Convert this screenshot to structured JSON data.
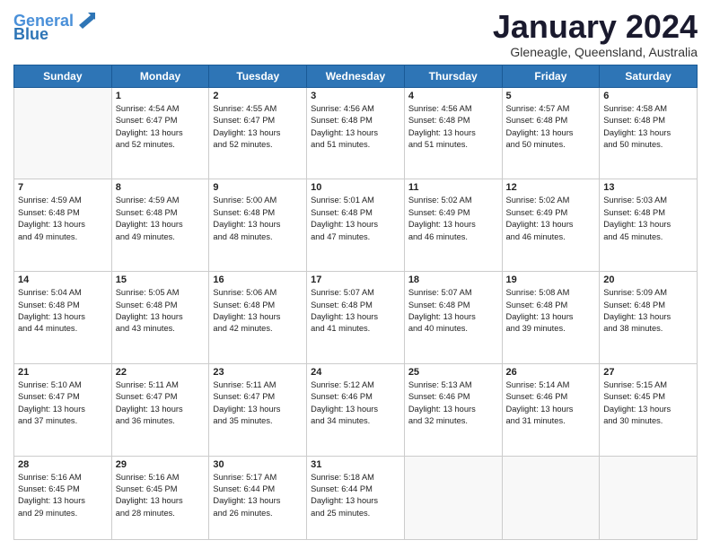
{
  "header": {
    "logo_line1": "General",
    "logo_line2": "Blue",
    "month": "January 2024",
    "location": "Gleneagle, Queensland, Australia"
  },
  "days_of_week": [
    "Sunday",
    "Monday",
    "Tuesday",
    "Wednesday",
    "Thursday",
    "Friday",
    "Saturday"
  ],
  "weeks": [
    [
      {
        "num": "",
        "info": ""
      },
      {
        "num": "1",
        "info": "Sunrise: 4:54 AM\nSunset: 6:47 PM\nDaylight: 13 hours\nand 52 minutes."
      },
      {
        "num": "2",
        "info": "Sunrise: 4:55 AM\nSunset: 6:47 PM\nDaylight: 13 hours\nand 52 minutes."
      },
      {
        "num": "3",
        "info": "Sunrise: 4:56 AM\nSunset: 6:48 PM\nDaylight: 13 hours\nand 51 minutes."
      },
      {
        "num": "4",
        "info": "Sunrise: 4:56 AM\nSunset: 6:48 PM\nDaylight: 13 hours\nand 51 minutes."
      },
      {
        "num": "5",
        "info": "Sunrise: 4:57 AM\nSunset: 6:48 PM\nDaylight: 13 hours\nand 50 minutes."
      },
      {
        "num": "6",
        "info": "Sunrise: 4:58 AM\nSunset: 6:48 PM\nDaylight: 13 hours\nand 50 minutes."
      }
    ],
    [
      {
        "num": "7",
        "info": "Sunrise: 4:59 AM\nSunset: 6:48 PM\nDaylight: 13 hours\nand 49 minutes."
      },
      {
        "num": "8",
        "info": "Sunrise: 4:59 AM\nSunset: 6:48 PM\nDaylight: 13 hours\nand 49 minutes."
      },
      {
        "num": "9",
        "info": "Sunrise: 5:00 AM\nSunset: 6:48 PM\nDaylight: 13 hours\nand 48 minutes."
      },
      {
        "num": "10",
        "info": "Sunrise: 5:01 AM\nSunset: 6:48 PM\nDaylight: 13 hours\nand 47 minutes."
      },
      {
        "num": "11",
        "info": "Sunrise: 5:02 AM\nSunset: 6:49 PM\nDaylight: 13 hours\nand 46 minutes."
      },
      {
        "num": "12",
        "info": "Sunrise: 5:02 AM\nSunset: 6:49 PM\nDaylight: 13 hours\nand 46 minutes."
      },
      {
        "num": "13",
        "info": "Sunrise: 5:03 AM\nSunset: 6:48 PM\nDaylight: 13 hours\nand 45 minutes."
      }
    ],
    [
      {
        "num": "14",
        "info": "Sunrise: 5:04 AM\nSunset: 6:48 PM\nDaylight: 13 hours\nand 44 minutes."
      },
      {
        "num": "15",
        "info": "Sunrise: 5:05 AM\nSunset: 6:48 PM\nDaylight: 13 hours\nand 43 minutes."
      },
      {
        "num": "16",
        "info": "Sunrise: 5:06 AM\nSunset: 6:48 PM\nDaylight: 13 hours\nand 42 minutes."
      },
      {
        "num": "17",
        "info": "Sunrise: 5:07 AM\nSunset: 6:48 PM\nDaylight: 13 hours\nand 41 minutes."
      },
      {
        "num": "18",
        "info": "Sunrise: 5:07 AM\nSunset: 6:48 PM\nDaylight: 13 hours\nand 40 minutes."
      },
      {
        "num": "19",
        "info": "Sunrise: 5:08 AM\nSunset: 6:48 PM\nDaylight: 13 hours\nand 39 minutes."
      },
      {
        "num": "20",
        "info": "Sunrise: 5:09 AM\nSunset: 6:48 PM\nDaylight: 13 hours\nand 38 minutes."
      }
    ],
    [
      {
        "num": "21",
        "info": "Sunrise: 5:10 AM\nSunset: 6:47 PM\nDaylight: 13 hours\nand 37 minutes."
      },
      {
        "num": "22",
        "info": "Sunrise: 5:11 AM\nSunset: 6:47 PM\nDaylight: 13 hours\nand 36 minutes."
      },
      {
        "num": "23",
        "info": "Sunrise: 5:11 AM\nSunset: 6:47 PM\nDaylight: 13 hours\nand 35 minutes."
      },
      {
        "num": "24",
        "info": "Sunrise: 5:12 AM\nSunset: 6:46 PM\nDaylight: 13 hours\nand 34 minutes."
      },
      {
        "num": "25",
        "info": "Sunrise: 5:13 AM\nSunset: 6:46 PM\nDaylight: 13 hours\nand 32 minutes."
      },
      {
        "num": "26",
        "info": "Sunrise: 5:14 AM\nSunset: 6:46 PM\nDaylight: 13 hours\nand 31 minutes."
      },
      {
        "num": "27",
        "info": "Sunrise: 5:15 AM\nSunset: 6:45 PM\nDaylight: 13 hours\nand 30 minutes."
      }
    ],
    [
      {
        "num": "28",
        "info": "Sunrise: 5:16 AM\nSunset: 6:45 PM\nDaylight: 13 hours\nand 29 minutes."
      },
      {
        "num": "29",
        "info": "Sunrise: 5:16 AM\nSunset: 6:45 PM\nDaylight: 13 hours\nand 28 minutes."
      },
      {
        "num": "30",
        "info": "Sunrise: 5:17 AM\nSunset: 6:44 PM\nDaylight: 13 hours\nand 26 minutes."
      },
      {
        "num": "31",
        "info": "Sunrise: 5:18 AM\nSunset: 6:44 PM\nDaylight: 13 hours\nand 25 minutes."
      },
      {
        "num": "",
        "info": ""
      },
      {
        "num": "",
        "info": ""
      },
      {
        "num": "",
        "info": ""
      }
    ]
  ]
}
